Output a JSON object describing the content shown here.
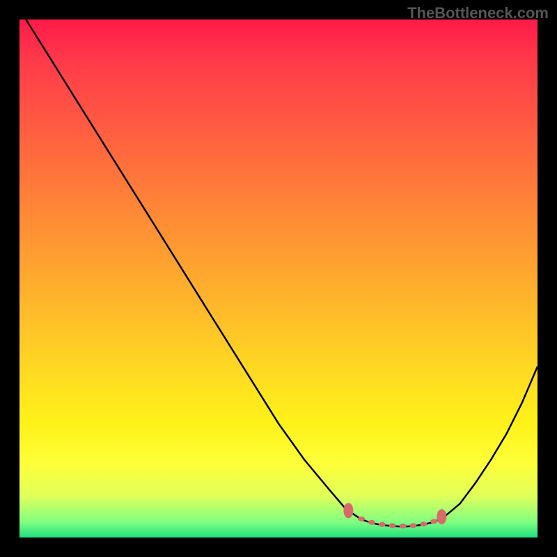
{
  "watermark": "TheBottleneck.com",
  "chart_data": {
    "type": "line",
    "title": "",
    "xlabel": "",
    "ylabel": "",
    "xlim": [
      0,
      100
    ],
    "ylim": [
      0,
      100
    ],
    "grid": false,
    "series": [
      {
        "name": "bottleneck-curve",
        "x": [
          0,
          5,
          10,
          15,
          20,
          25,
          30,
          35,
          40,
          45,
          50,
          55,
          60,
          63,
          66,
          68,
          70,
          72,
          74,
          76,
          78,
          80,
          82,
          85,
          88,
          91,
          94,
          97,
          100
        ],
        "values": [
          102,
          94,
          86,
          78,
          70,
          62,
          54,
          46,
          38,
          30,
          22,
          15,
          9,
          5.5,
          3.5,
          2.8,
          2.4,
          2.2,
          2.1,
          2.2,
          2.5,
          3,
          4,
          6.5,
          10.5,
          15,
          20,
          26,
          33
        ]
      }
    ],
    "markers": {
      "name": "highlighted-range",
      "points": [
        {
          "x": 63.5,
          "y": 5.2
        },
        {
          "x": 66,
          "y": 3.6
        },
        {
          "x": 68,
          "y": 2.9
        },
        {
          "x": 70,
          "y": 2.5
        },
        {
          "x": 72,
          "y": 2.3
        },
        {
          "x": 74,
          "y": 2.2
        },
        {
          "x": 76,
          "y": 2.3
        },
        {
          "x": 78,
          "y": 2.6
        },
        {
          "x": 80,
          "y": 3.1
        },
        {
          "x": 81.5,
          "y": 4.0
        }
      ]
    },
    "background_gradient": [
      "#ff1a4a",
      "#ffda22",
      "#20e080"
    ]
  }
}
